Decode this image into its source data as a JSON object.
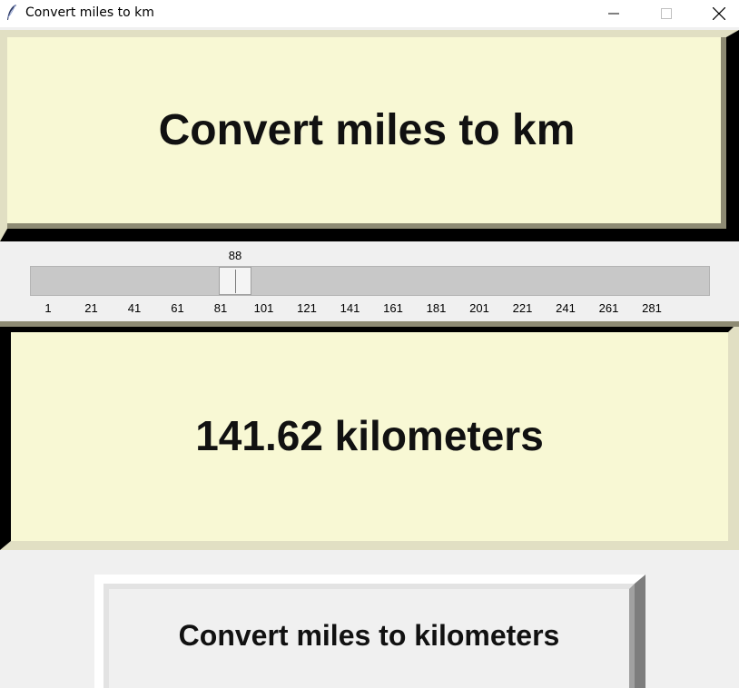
{
  "window": {
    "title": "Convert miles to km",
    "icon": "feather-icon",
    "controls": [
      "minimize-icon",
      "maximize-icon",
      "close-icon"
    ]
  },
  "header": {
    "text": "Convert miles to km"
  },
  "slider": {
    "value": 88,
    "value_text": "88",
    "min": 1,
    "max": 300,
    "ticks": [
      "1",
      "21",
      "41",
      "61",
      "81",
      "101",
      "121",
      "141",
      "161",
      "181",
      "201",
      "221",
      "241",
      "261",
      "281"
    ]
  },
  "result": {
    "text": "141.62 kilometers"
  },
  "convert_button": {
    "label": "Convert miles to kilometers"
  },
  "colors": {
    "panel_background": "#f8f8d4",
    "window_background": "#f0f0f0",
    "trough": "#c8c8c8"
  }
}
